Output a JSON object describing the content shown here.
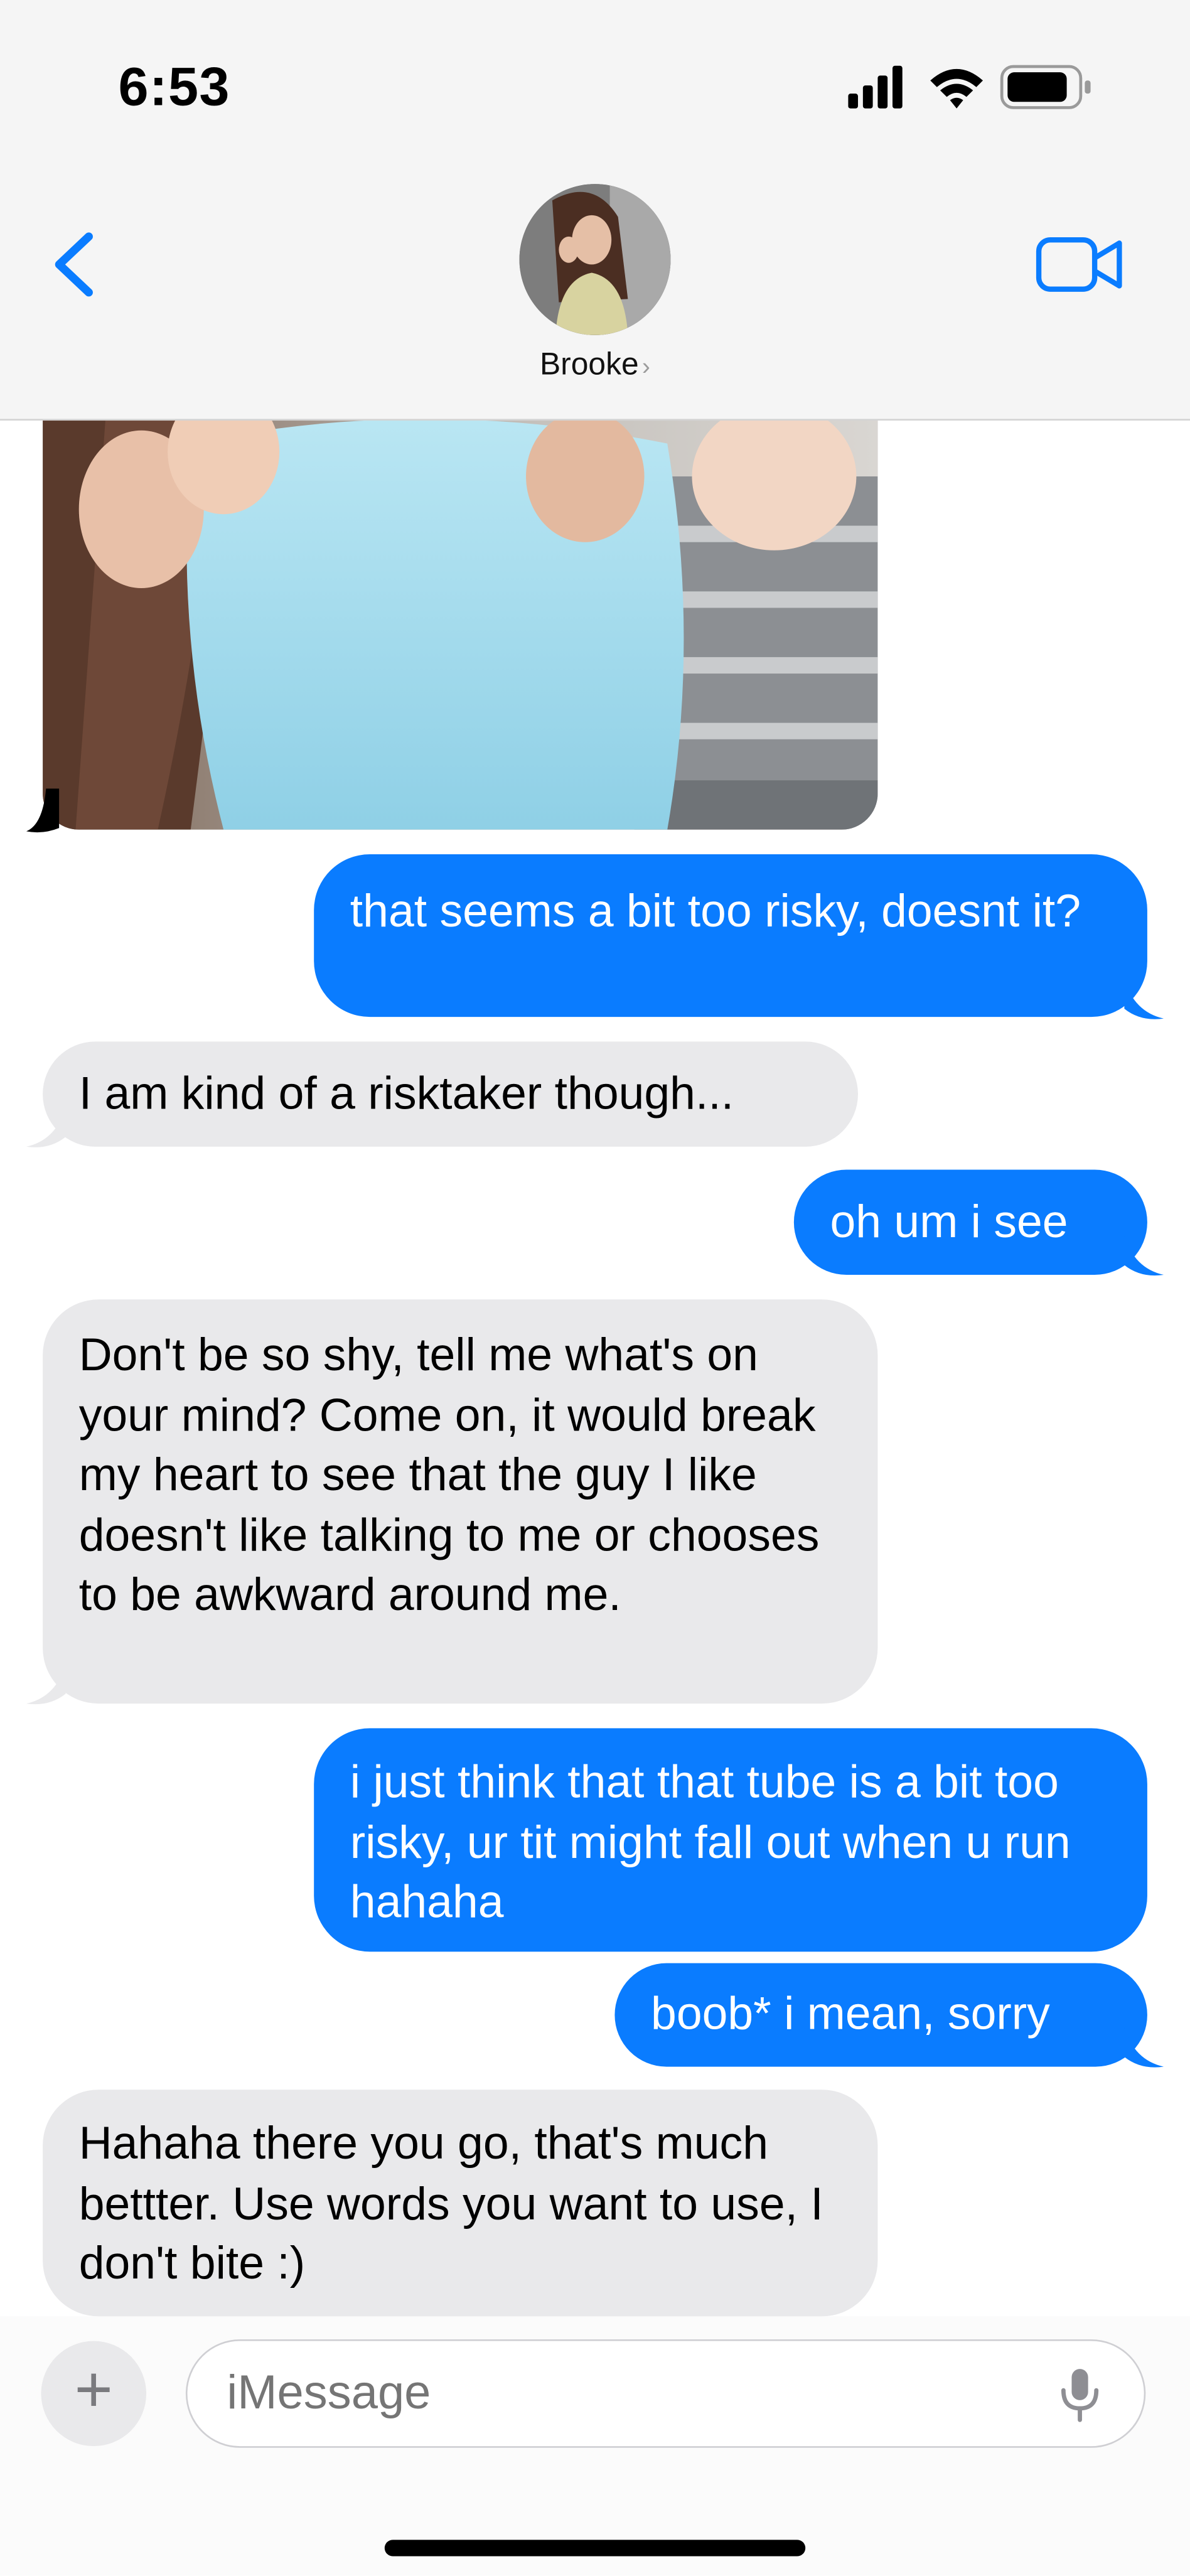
{
  "status_bar": {
    "time": "6:53"
  },
  "header": {
    "contact_name": "Brooke",
    "chevron": "›",
    "icons": [
      "back-chevron-icon",
      "video-camera-icon"
    ]
  },
  "messages": [
    {
      "type": "image",
      "direction": "in"
    },
    {
      "direction": "out",
      "text": "that seems a bit too risky, doesnt it?"
    },
    {
      "direction": "in",
      "text": "I am kind of a risktaker though..."
    },
    {
      "direction": "out",
      "text": "oh um i see"
    },
    {
      "direction": "in",
      "text": "Don't be so shy, tell me what's on your mind? Come on, it would break my heart to see that the guy I like doesn't like talking to me or chooses to be awkward around me."
    },
    {
      "direction": "out",
      "text": "i just think that that tube is a bit too risky, ur tit might fall out when u run hahaha"
    },
    {
      "direction": "out",
      "text": "boob* i mean, sorry"
    },
    {
      "direction": "in",
      "text": "Hahaha there you go, that's much bettter. Use words you want to use, I don't bite :)"
    }
  ],
  "composer": {
    "plus_label": "+",
    "placeholder": "iMessage"
  },
  "colors": {
    "outgoing_bubble": "#0a7cff",
    "incoming_bubble": "#e9e9eb",
    "accent": "#0a7cff"
  }
}
